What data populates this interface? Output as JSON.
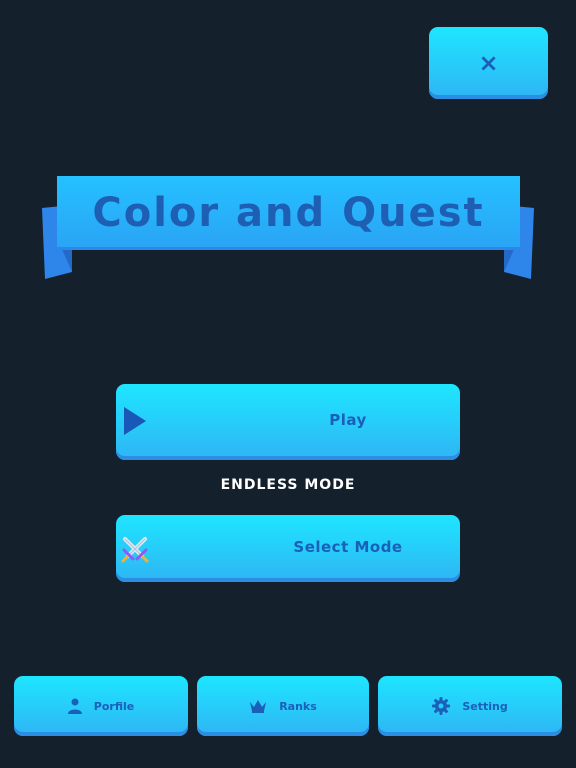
{
  "header": {
    "close_label": "×"
  },
  "banner": {
    "title": "Color and Quest"
  },
  "main": {
    "play_label": "Play",
    "mode_label": "ENDLESS MODE",
    "select_mode_label": "Select Mode"
  },
  "footer": {
    "profile_label": "Porfile",
    "ranks_label": "Ranks",
    "setting_label": "Setting"
  },
  "colors": {
    "background": "#15202d",
    "button_top": "#1ee6ff",
    "button_bottom": "#2fb4f4",
    "text_blue": "#1a5fb8"
  },
  "icons": {
    "play": "play-icon",
    "select": "crossed-swords-icon",
    "profile": "person-icon",
    "ranks": "crown-icon",
    "setting": "gear-icon"
  }
}
